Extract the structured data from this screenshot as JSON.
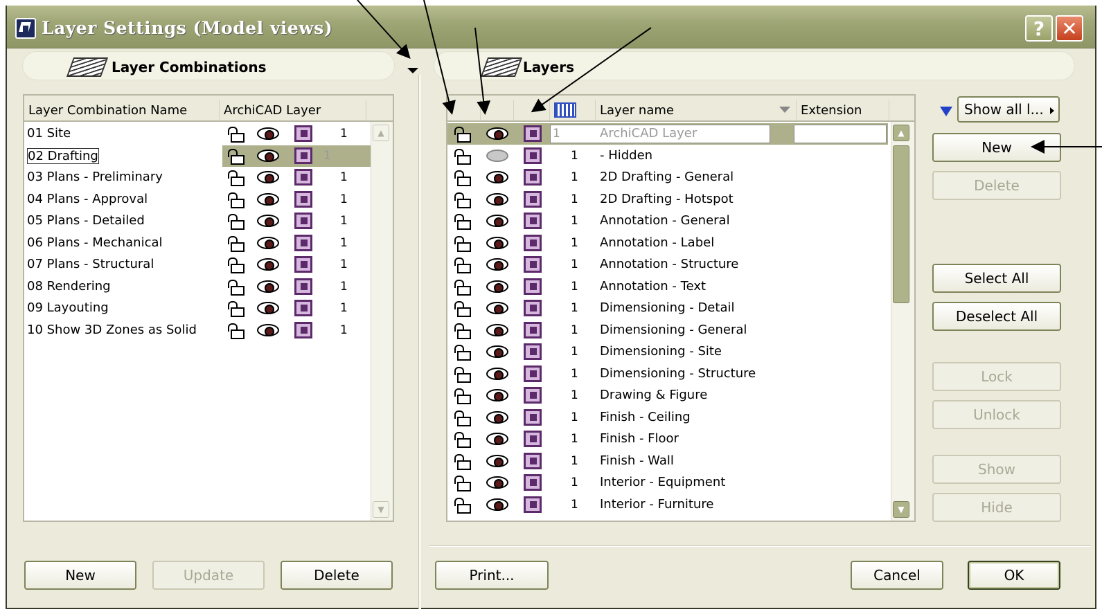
{
  "window": {
    "title": "Layer Settings (Model views)",
    "help_label": "?",
    "close_label": "✕"
  },
  "left_panel": {
    "title": "Layer Combinations",
    "columns": [
      "Layer Combination Name",
      "ArchiCAD Layer"
    ],
    "rows": [
      {
        "name": "01 Site",
        "num": "1"
      },
      {
        "name": "02 Drafting",
        "num": "1"
      },
      {
        "name": "03 Plans - Preliminary",
        "num": "1"
      },
      {
        "name": "04 Plans - Approval",
        "num": "1"
      },
      {
        "name": "05 Plans - Detailed",
        "num": "1"
      },
      {
        "name": "06 Plans - Mechanical",
        "num": "1"
      },
      {
        "name": "07 Plans - Structural",
        "num": "1"
      },
      {
        "name": "08 Rendering",
        "num": "1"
      },
      {
        "name": "09 Layouting",
        "num": "1"
      },
      {
        "name": "10 Show 3D Zones as Solid",
        "num": "1"
      }
    ],
    "buttons": {
      "new": "New",
      "update": "Update",
      "delete": "Delete"
    }
  },
  "right_panel": {
    "title": "Layers",
    "columns": {
      "name": "Layer name",
      "extension": "Extension"
    },
    "rows": [
      {
        "name": "ArchiCAD Layer",
        "num": "1"
      },
      {
        "name": "- Hidden",
        "num": "1"
      },
      {
        "name": "2D Drafting - General",
        "num": "1"
      },
      {
        "name": "2D Drafting - Hotspot",
        "num": "1"
      },
      {
        "name": "Annotation - General",
        "num": "1"
      },
      {
        "name": "Annotation - Label",
        "num": "1"
      },
      {
        "name": "Annotation - Structure",
        "num": "1"
      },
      {
        "name": "Annotation - Text",
        "num": "1"
      },
      {
        "name": "Dimensioning - Detail",
        "num": "1"
      },
      {
        "name": "Dimensioning - General",
        "num": "1"
      },
      {
        "name": "Dimensioning - Site",
        "num": "1"
      },
      {
        "name": "Dimensioning - Structure",
        "num": "1"
      },
      {
        "name": "Drawing & Figure",
        "num": "1"
      },
      {
        "name": "Finish - Ceiling",
        "num": "1"
      },
      {
        "name": "Finish - Floor",
        "num": "1"
      },
      {
        "name": "Finish - Wall",
        "num": "1"
      },
      {
        "name": "Interior - Equipment",
        "num": "1"
      },
      {
        "name": "Interior - Furniture",
        "num": "1"
      }
    ],
    "filter_label": "Show all l...",
    "side_buttons": {
      "new": "New",
      "delete": "Delete",
      "select_all": "Select All",
      "deselect_all": "Deselect All",
      "lock": "Lock",
      "unlock": "Unlock",
      "show": "Show",
      "hide": "Hide"
    }
  },
  "footer": {
    "print": "Print...",
    "cancel": "Cancel",
    "ok": "OK"
  },
  "colors": {
    "title_bar": "#9fa676",
    "selection": "#adb08a",
    "window_bg": "#ebeadb",
    "pen_icon": "#5c2a6a",
    "filter_icon": "#2041c8"
  }
}
